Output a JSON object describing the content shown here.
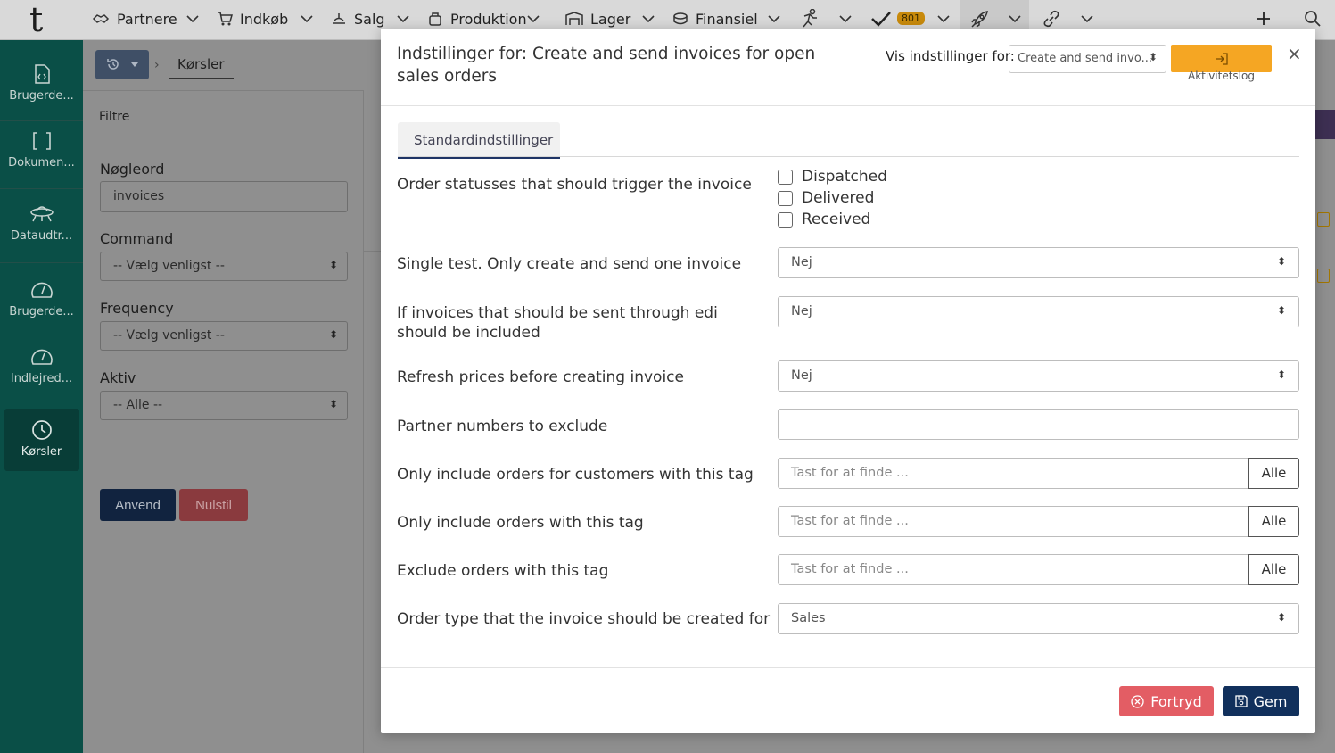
{
  "topnav": {
    "logo": "t",
    "items": [
      {
        "label": "Partnere",
        "icon": "partners-icon"
      },
      {
        "label": "Indkøb",
        "icon": "cart-icon"
      },
      {
        "label": "Salg",
        "icon": "sales-icon"
      },
      {
        "label": "Produktion",
        "icon": "production-icon"
      },
      {
        "label": "Lager",
        "icon": "warehouse-icon"
      },
      {
        "label": "Finansiel",
        "icon": "finance-icon"
      }
    ],
    "tasks_badge": "801"
  },
  "sidebar": {
    "items": [
      {
        "label": "Brugerde...",
        "icon": "user-defined-code-icon"
      },
      {
        "label": "Dokumen...",
        "icon": "document-brackets-icon"
      },
      {
        "label": "Dataudtr...",
        "icon": "data-extract-icon"
      },
      {
        "label": "Brugerde...",
        "icon": "dashboard-gauge-icon"
      },
      {
        "label": "Indlejred...",
        "icon": "embedded-gauge-icon"
      },
      {
        "label": "Kørsler",
        "icon": "clock-icon"
      }
    ]
  },
  "breadcrumb": {
    "current": "Kørsler"
  },
  "filters": {
    "title": "Filtre",
    "keyword_label": "Nøgleord",
    "keyword_value": "invoices",
    "command_label": "Command",
    "command_value": "-- Vælg venligst --",
    "frequency_label": "Frequency",
    "frequency_value": "-- Vælg venligst --",
    "active_label": "Aktiv",
    "active_value": "-- Alle --",
    "apply": "Anvend",
    "reset": "Nulstil"
  },
  "modal": {
    "title": "Indstillinger for: Create and send invoices for open sales orders",
    "show_settings_for_label": "Vis indstillinger for:",
    "show_settings_for_value": "Create and send invo...",
    "activity_log_label": "Aktivitetslog",
    "close": "×",
    "tab": "Standardindstillinger",
    "order_statuses_label": "Order statusses that should trigger the invoice",
    "statuses": [
      "Dispatched",
      "Delivered",
      "Received"
    ],
    "single_test_label": "Single test. Only create and send one invoice",
    "single_test_value": "Nej",
    "edi_label": "If invoices that should be sent through edi should be included",
    "edi_value": "Nej",
    "refresh_label": "Refresh prices before creating invoice",
    "refresh_value": "Nej",
    "partner_exclude_label": "Partner numbers to exclude",
    "partner_exclude_value": "",
    "customer_tag_label": "Only include orders for customers with this tag",
    "order_tag_label": "Only include orders with this tag",
    "exclude_tag_label": "Exclude orders with this tag",
    "tag_placeholder": "Tast for at finde ...",
    "tag_button": "Alle",
    "order_type_label": "Order type that the invoice should be created for",
    "order_type_value": "Sales",
    "cancel": "Fortryd",
    "save": "Gem"
  },
  "colors": {
    "sidebar": "#0a4f47",
    "primary_button": "#11305c",
    "cancel_button": "#e35d64",
    "activity_button": "#f5a623",
    "badge": "#c88a0c"
  }
}
